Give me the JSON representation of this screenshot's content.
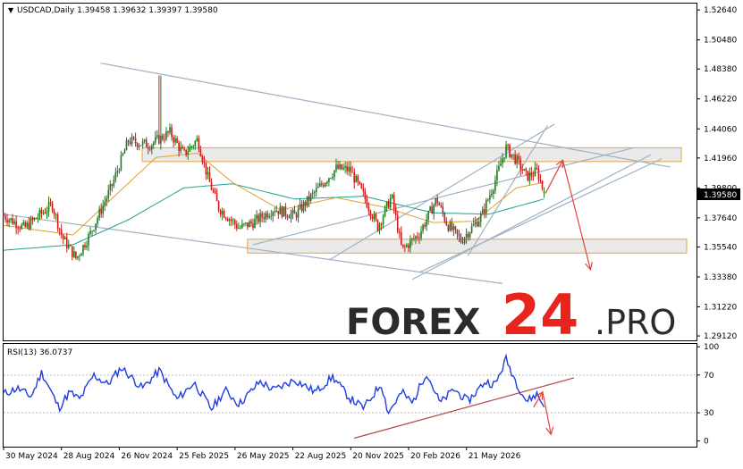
{
  "symbol_header": "USDCAD,Daily  1.39458 1.39632 1.39397 1.39580",
  "current_price_label": "1.39580",
  "watermark": {
    "main": "FOREX",
    "number": "24",
    "suffix": ".PRO",
    "colors": {
      "main": "#2b2b2b",
      "number": "#e8241c",
      "suffix": "#2b2b2b"
    }
  },
  "colors": {
    "bull_candle": "#1a7f1a",
    "bear_candle": "#c81e1e",
    "ma_fast": "#e0a030",
    "ma_slow": "#1f9e8e",
    "channel_lines": "#9fb1c4",
    "zone_fill": "#e6e6e6",
    "zone_border": "#e8a33a",
    "forecast_arrow": "#e8413a",
    "rsi_line": "#1f3de0",
    "rsi_trend": "#b0474b"
  },
  "chart_data": [
    {
      "type": "candlestick",
      "title": "",
      "symbol": "USDCAD",
      "timeframe": "Daily",
      "ohlc_last": {
        "open": 1.39458,
        "high": 1.39632,
        "low": 1.39397,
        "close": 1.3958
      },
      "y_ticks": [
        "1.52640",
        "1.50480",
        "1.48380",
        "1.46220",
        "1.44060",
        "1.41960",
        "1.39800",
        "1.37640",
        "1.35540",
        "1.33380",
        "1.31220",
        "1.29120"
      ],
      "ylim": [
        1.288,
        1.531
      ],
      "x_ticks": [
        "30 May 2024",
        "28 Aug 2024",
        "26 Nov 2024",
        "25 Feb 2025",
        "26 May 2025",
        "22 Aug 2025",
        "20 Nov 2025",
        "20 Feb 2026",
        "21 May 2026"
      ],
      "key_points": [
        {
          "x": 0,
          "y": 1.378
        },
        {
          "x": 0.03,
          "y": 1.369
        },
        {
          "x": 0.07,
          "y": 1.386
        },
        {
          "x": 0.085,
          "y": 1.362
        },
        {
          "x": 0.105,
          "y": 1.347
        },
        {
          "x": 0.125,
          "y": 1.365
        },
        {
          "x": 0.155,
          "y": 1.398
        },
        {
          "x": 0.18,
          "y": 1.432
        },
        {
          "x": 0.21,
          "y": 1.429
        },
        {
          "x": 0.24,
          "y": 1.438
        },
        {
          "x": 0.26,
          "y": 1.422
        },
        {
          "x": 0.28,
          "y": 1.433
        },
        {
          "x": 0.295,
          "y": 1.405
        },
        {
          "x": 0.31,
          "y": 1.384
        },
        {
          "x": 0.34,
          "y": 1.369
        },
        {
          "x": 0.36,
          "y": 1.373
        },
        {
          "x": 0.39,
          "y": 1.383
        },
        {
          "x": 0.42,
          "y": 1.378
        },
        {
          "x": 0.46,
          "y": 1.401
        },
        {
          "x": 0.48,
          "y": 1.412
        },
        {
          "x": 0.5,
          "y": 1.411
        },
        {
          "x": 0.52,
          "y": 1.392
        },
        {
          "x": 0.54,
          "y": 1.37
        },
        {
          "x": 0.56,
          "y": 1.392
        },
        {
          "x": 0.575,
          "y": 1.353
        },
        {
          "x": 0.6,
          "y": 1.365
        },
        {
          "x": 0.625,
          "y": 1.39
        },
        {
          "x": 0.64,
          "y": 1.372
        },
        {
          "x": 0.66,
          "y": 1.36
        },
        {
          "x": 0.69,
          "y": 1.378
        },
        {
          "x": 0.71,
          "y": 1.404
        },
        {
          "x": 0.725,
          "y": 1.427
        },
        {
          "x": 0.74,
          "y": 1.418
        },
        {
          "x": 0.755,
          "y": 1.406
        },
        {
          "x": 0.77,
          "y": 1.41
        },
        {
          "x": 0.78,
          "y": 1.395
        }
      ],
      "ma_fast_points": [
        {
          "x": 0,
          "y": 1.371
        },
        {
          "x": 0.1,
          "y": 1.364
        },
        {
          "x": 0.16,
          "y": 1.392
        },
        {
          "x": 0.22,
          "y": 1.42
        },
        {
          "x": 0.28,
          "y": 1.423
        },
        {
          "x": 0.33,
          "y": 1.402
        },
        {
          "x": 0.4,
          "y": 1.382
        },
        {
          "x": 0.48,
          "y": 1.391
        },
        {
          "x": 0.55,
          "y": 1.384
        },
        {
          "x": 0.62,
          "y": 1.373
        },
        {
          "x": 0.68,
          "y": 1.374
        },
        {
          "x": 0.74,
          "y": 1.398
        },
        {
          "x": 0.78,
          "y": 1.402
        }
      ],
      "ma_slow_points": [
        {
          "x": 0,
          "y": 1.353
        },
        {
          "x": 0.1,
          "y": 1.357
        },
        {
          "x": 0.18,
          "y": 1.375
        },
        {
          "x": 0.26,
          "y": 1.398
        },
        {
          "x": 0.33,
          "y": 1.401
        },
        {
          "x": 0.42,
          "y": 1.39
        },
        {
          "x": 0.52,
          "y": 1.392
        },
        {
          "x": 0.62,
          "y": 1.38
        },
        {
          "x": 0.7,
          "y": 1.379
        },
        {
          "x": 0.78,
          "y": 1.39
        }
      ],
      "zones": [
        {
          "name": "resistance-zone",
          "y_top": 1.427,
          "y_bottom": 1.417,
          "x_from": 0.2,
          "x_to": 1.0
        },
        {
          "name": "support-zone",
          "y_top": 1.361,
          "y_bottom": 1.351,
          "x_from": 0.352,
          "x_to": 1.0
        }
      ],
      "trend_lines": [
        {
          "name": "upper-channel",
          "from": {
            "x": 0.14,
            "y": 1.488
          },
          "to": {
            "x": 1.0,
            "y": 1.413
          }
        },
        {
          "name": "lower-channel",
          "from": {
            "x": 0.0,
            "y": 1.379
          },
          "to": {
            "x": 0.72,
            "y": 1.329
          }
        },
        {
          "name": "rising-1",
          "from": {
            "x": 0.36,
            "y": 1.357
          },
          "to": {
            "x": 0.91,
            "y": 1.427
          }
        },
        {
          "name": "rising-2",
          "from": {
            "x": 0.47,
            "y": 1.346
          },
          "to": {
            "x": 0.795,
            "y": 1.444
          }
        },
        {
          "name": "rising-3",
          "from": {
            "x": 0.6,
            "y": 1.337
          },
          "to": {
            "x": 1.0,
            "y": 1.419
          }
        },
        {
          "name": "rising-4",
          "from": {
            "x": 0.59,
            "y": 1.332
          },
          "to": {
            "x": 0.99,
            "y": 1.422
          }
        },
        {
          "name": "rising-5",
          "from": {
            "x": 0.67,
            "y": 1.349
          },
          "to": {
            "x": 0.785,
            "y": 1.443
          }
        }
      ],
      "forecast_arrows": [
        {
          "name": "forecast-up",
          "from": {
            "x": 0.782,
            "y": 1.394
          },
          "to": {
            "x": 0.807,
            "y": 1.418
          }
        },
        {
          "name": "forecast-down",
          "from": {
            "x": 0.807,
            "y": 1.418
          },
          "to": {
            "x": 0.847,
            "y": 1.339
          }
        }
      ]
    },
    {
      "type": "line",
      "title": "RSI(13) 36.0737",
      "indicator": "RSI",
      "period": 13,
      "value": 36.0737,
      "y_ticks": [
        "100",
        "70",
        "30",
        "0"
      ],
      "ylim": [
        -6,
        103
      ],
      "levels": [
        70,
        30
      ],
      "key_points": [
        {
          "x": 0,
          "y": 50
        },
        {
          "x": 0.02,
          "y": 56
        },
        {
          "x": 0.04,
          "y": 47
        },
        {
          "x": 0.055,
          "y": 73
        },
        {
          "x": 0.08,
          "y": 35
        },
        {
          "x": 0.095,
          "y": 52
        },
        {
          "x": 0.11,
          "y": 44
        },
        {
          "x": 0.13,
          "y": 70
        },
        {
          "x": 0.15,
          "y": 60
        },
        {
          "x": 0.17,
          "y": 78
        },
        {
          "x": 0.2,
          "y": 56
        },
        {
          "x": 0.225,
          "y": 75
        },
        {
          "x": 0.25,
          "y": 44
        },
        {
          "x": 0.275,
          "y": 62
        },
        {
          "x": 0.3,
          "y": 34
        },
        {
          "x": 0.32,
          "y": 54
        },
        {
          "x": 0.34,
          "y": 39
        },
        {
          "x": 0.37,
          "y": 63
        },
        {
          "x": 0.39,
          "y": 54
        },
        {
          "x": 0.42,
          "y": 65
        },
        {
          "x": 0.45,
          "y": 52
        },
        {
          "x": 0.475,
          "y": 68
        },
        {
          "x": 0.5,
          "y": 45
        },
        {
          "x": 0.52,
          "y": 35
        },
        {
          "x": 0.545,
          "y": 61
        },
        {
          "x": 0.555,
          "y": 30
        },
        {
          "x": 0.575,
          "y": 52
        },
        {
          "x": 0.59,
          "y": 40
        },
        {
          "x": 0.61,
          "y": 73
        },
        {
          "x": 0.63,
          "y": 40
        },
        {
          "x": 0.65,
          "y": 55
        },
        {
          "x": 0.67,
          "y": 42
        },
        {
          "x": 0.695,
          "y": 63
        },
        {
          "x": 0.71,
          "y": 60
        },
        {
          "x": 0.725,
          "y": 87
        },
        {
          "x": 0.74,
          "y": 62
        },
        {
          "x": 0.755,
          "y": 42
        },
        {
          "x": 0.77,
          "y": 50
        },
        {
          "x": 0.78,
          "y": 36
        }
      ],
      "trend_line": {
        "from": {
          "x": 0.506,
          "y": 3
        },
        "to": {
          "x": 1.0,
          "y": 67
        }
      },
      "forecast_arrows": [
        {
          "name": "rsi-forecast-up",
          "from": {
            "x": 0.765,
            "y": 36
          },
          "to": {
            "x": 0.778,
            "y": 52
          }
        },
        {
          "name": "rsi-forecast-down",
          "from": {
            "x": 0.778,
            "y": 52
          },
          "to": {
            "x": 0.79,
            "y": 7
          }
        }
      ]
    }
  ]
}
